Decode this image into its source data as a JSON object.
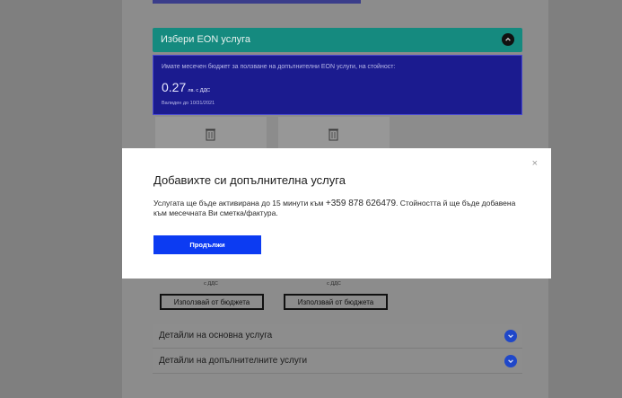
{
  "section": {
    "title": "Избери EON услуга",
    "toggle_icon": "chevron-up-icon"
  },
  "budget": {
    "description": "Имате месечен бюджет за ползване на допълнителни EON услуги, на стойност:",
    "amount": "0.27",
    "amount_suffix": "лв. с ДДС",
    "valid_until": "Валиден до 10/31/2021"
  },
  "cards": [
    {
      "icon": "trash-icon",
      "vat_label": "с ДДС",
      "button_label": "Използвай от бюджета"
    },
    {
      "icon": "trash-icon",
      "vat_label": "с ДДС",
      "button_label": "Използвай от бюджета"
    }
  ],
  "accordions": [
    {
      "label": "Детайли на основна услуга",
      "icon": "chevron-down-icon"
    },
    {
      "label": "Детайли на допълнителните услуги",
      "icon": "chevron-down-icon"
    }
  ],
  "modal": {
    "close_glyph": "×",
    "heading": "Добавихте си допълнителна услуга",
    "body_before": "Услугата ще бъде активирана до 15 минути към ",
    "phone": "+359 878 626479",
    "body_after": ". Стойността й ще бъде добавена към месечната Ви сметка/фактура.",
    "continue_label": "Продължи"
  },
  "colors": {
    "overlay": "#7f7f7f",
    "section_header": "#158a7f",
    "budget_box": "#1b1b8f",
    "accent_blue": "#0c3bf2",
    "accordion_icon": "#1f47c9"
  }
}
